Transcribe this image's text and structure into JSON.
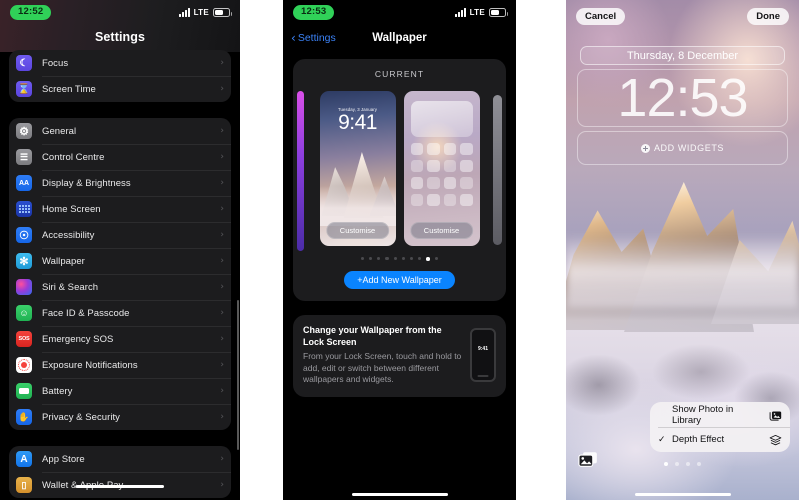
{
  "panel_settings": {
    "status": {
      "time": "12:52",
      "network": "LTE",
      "signal_icon": "cellular-bars-icon",
      "battery_icon": "battery-icon"
    },
    "nav_title": "Settings",
    "groups": [
      {
        "items": [
          {
            "label": "Focus",
            "icon": "moon-icon",
            "icon_class": "ic-focus",
            "glyph": "☾"
          },
          {
            "label": "Screen Time",
            "icon": "hourglass-icon",
            "icon_class": "ic-screentime",
            "glyph": "⧖"
          }
        ]
      },
      {
        "items": [
          {
            "label": "General",
            "icon": "gear-icon",
            "icon_class": "ic-general",
            "glyph": "⚙"
          },
          {
            "label": "Control Centre",
            "icon": "sliders-icon",
            "icon_class": "ic-control",
            "glyph": "⌸"
          },
          {
            "label": "Display & Brightness",
            "icon": "aa-icon",
            "icon_class": "ic-display",
            "glyph": "AA"
          },
          {
            "label": "Home Screen",
            "icon": "app-grid-icon",
            "icon_class": "ic-home",
            "glyph": "grid"
          },
          {
            "label": "Accessibility",
            "icon": "accessibility-icon",
            "icon_class": "ic-access",
            "glyph": "Ⓙ"
          },
          {
            "label": "Wallpaper",
            "icon": "flower-icon",
            "icon_class": "ic-wallpaper",
            "glyph": "✻"
          },
          {
            "label": "Siri & Search",
            "icon": "siri-orb-icon",
            "icon_class": "ic-siri",
            "glyph": ""
          },
          {
            "label": "Face ID & Passcode",
            "icon": "face-id-icon",
            "icon_class": "ic-faceid",
            "glyph": "☺"
          },
          {
            "label": "Emergency SOS",
            "icon": "sos-icon",
            "icon_class": "ic-sos",
            "glyph": "SOS"
          },
          {
            "label": "Exposure Notifications",
            "icon": "exposure-dot-icon",
            "icon_class": "ic-exposure",
            "glyph": "exposure"
          },
          {
            "label": "Battery",
            "icon": "battery-icon",
            "icon_class": "ic-battery",
            "glyph": "batt"
          },
          {
            "label": "Privacy & Security",
            "icon": "hand-icon",
            "icon_class": "ic-privacy",
            "glyph": "✋"
          }
        ]
      },
      {
        "items": [
          {
            "label": "App Store",
            "icon": "app-store-icon",
            "icon_class": "ic-appstore",
            "glyph": "A"
          },
          {
            "label": "Wallet & Apple Pay",
            "icon": "wallet-icon",
            "icon_class": "ic-wallet",
            "glyph": "▭"
          }
        ]
      }
    ],
    "chevron": "›"
  },
  "panel_wallpaper": {
    "status": {
      "time": "12:53",
      "network": "LTE"
    },
    "back_label": "Settings",
    "back_chevron": "‹",
    "nav_title": "Wallpaper",
    "current_label": "CURRENT",
    "previews": [
      {
        "kind": "lock-screen-preview",
        "date": "Tuesday, 3 January",
        "time": "9:41",
        "button": "Customise"
      },
      {
        "kind": "home-screen-preview",
        "button": "Customise"
      }
    ],
    "page_dots": {
      "count": 10,
      "active_index": 8
    },
    "add_button": "+Add New Wallpaper",
    "info_card": {
      "title": "Change your Wallpaper from the Lock Screen",
      "body": "From your Lock Screen, touch and hold to add, edit or switch between different wallpapers and widgets.",
      "phone_time": "9:41"
    }
  },
  "panel_lockscreen": {
    "cancel_label": "Cancel",
    "done_label": "Done",
    "date": "Thursday, 8 December",
    "clock": "12:53",
    "add_widgets_label": "ADD WIDGETS",
    "context_menu": {
      "items": [
        {
          "label": "Show Photo in Library",
          "icon": "photo-library-icon",
          "checked": false
        },
        {
          "label": "Depth Effect",
          "icon": "layers-icon",
          "checked": true
        }
      ],
      "check_glyph": "✓"
    },
    "photo_picker_icon": "photo-stack-icon",
    "page_dots": {
      "count": 4,
      "active_index": 0
    }
  },
  "colors": {
    "accent_blue": "#0a84ff",
    "link_blue": "#3b82f6",
    "status_green": "#30d158",
    "list_bg": "#1c1c1e",
    "page_bg": "#000000"
  }
}
